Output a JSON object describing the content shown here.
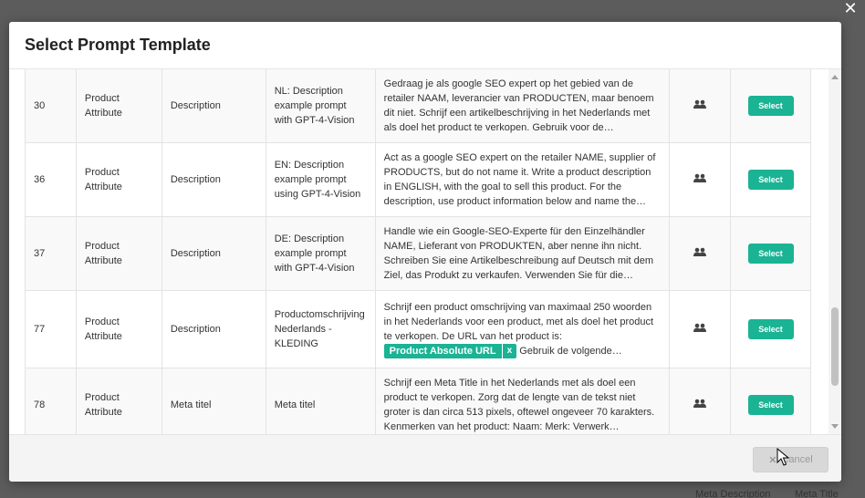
{
  "modal": {
    "title": "Select Prompt Template",
    "rows": [
      {
        "id": "30",
        "type": "Product Attribute",
        "field": "Description",
        "name": "NL: Description example prompt with GPT-4-Vision",
        "text": "Gedraag je als google SEO expert op het gebied van de retailer NAAM, leverancier van PRODUCTEN, maar benoem dit niet. Schrijf een artikelbeschrijving in het Nederlands met als doel het product te verkopen. Gebruik voor de…",
        "select_label": "Select"
      },
      {
        "id": "36",
        "type": "Product Attribute",
        "field": "Description",
        "name": "EN: Description example prompt using GPT-4-Vision",
        "text": "Act as a google SEO expert on the retailer NAME, supplier of PRODUCTS, but do not name it. Write a product description in ENGLISH, with the goal to sell this product. For the description, use product information below and name the…",
        "select_label": "Select"
      },
      {
        "id": "37",
        "type": "Product Attribute",
        "field": "Description",
        "name": "DE: Description example prompt with GPT-4-Vision",
        "text": "Handle wie ein Google-SEO-Experte für den Einzelhändler NAME, Lieferant von PRODUKTEN, aber nenne ihn nicht. Schreiben Sie eine Artikelbeschreibung auf Deutsch mit dem Ziel, das Produkt zu verkaufen. Verwenden Sie für die…",
        "select_label": "Select"
      },
      {
        "id": "77",
        "type": "Product Attribute",
        "field": "Description",
        "name": "Productomschrijving Nederlands - KLEDING",
        "text": "Schrijf een product omschrijving van maximaal 250 woorden in het Nederlands voor een product, met als doel het product te verkopen. De URL van het product is:",
        "tag": "Product Absolute URL",
        "tag_remove": "x",
        "text_after": "Gebruik de volgende…",
        "select_label": "Select"
      },
      {
        "id": "78",
        "type": "Product Attribute",
        "field": "Meta titel",
        "name": "Meta titel",
        "text": "Schrijf een Meta Title in het Nederlands met als doel een product te verkopen. Zorg dat de lengte van de tekst niet groter is dan circa 513 pixels, oftewel ongeveer 70 karakters. Kenmerken van het product: Naam: Merk: Verwerk…",
        "select_label": "Select"
      }
    ],
    "icons": {
      "share": "users-icon",
      "close": "close-icon"
    },
    "cancel_label": "Cancel",
    "accent_color": "#1ab394"
  },
  "background": {
    "peek_1": "Meta Description",
    "peek_2": "Meta Title"
  }
}
